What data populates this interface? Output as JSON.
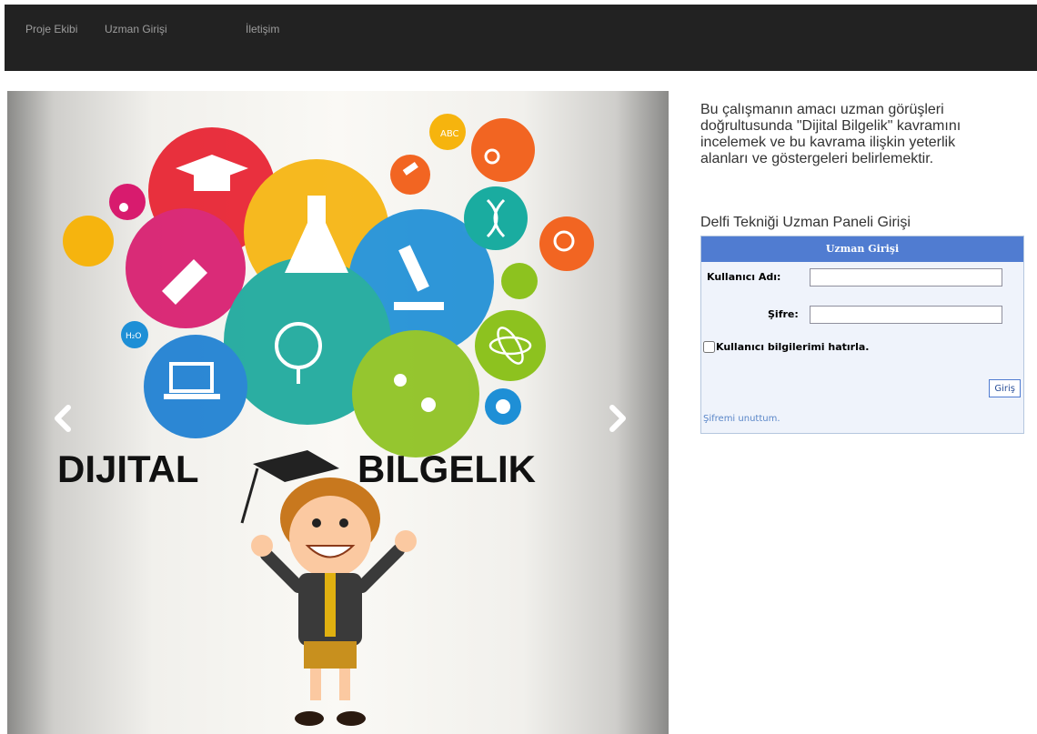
{
  "navbar": {
    "items": [
      {
        "label": "Proje Ekibi"
      },
      {
        "label": "Uzman Girişi"
      },
      {
        "label": "İletişim"
      }
    ],
    "background": "#222222"
  },
  "carousel": {
    "slide_title_left": "DIJITAL",
    "slide_title_right": "BILGELIK",
    "circle_badge_1": "ABC",
    "circle_badge_2": "H₂O",
    "prev_icon": "chevron-left-icon",
    "next_icon": "chevron-right-icon"
  },
  "intro": {
    "text": "Bu çalışmanın amacı uzman görüşleri doğrultusunda \"Dijital Bilgelik\" kavramını incelemek ve bu kavrama ilişkin yeterlik alanları ve göstergeleri belirlemektir."
  },
  "panel_title": "Delfi Tekniği Uzman Paneli Girişi",
  "login": {
    "header": "Uzman Girişi",
    "username_label": "Kullanıcı Adı:",
    "username_value": "",
    "password_label": "Şifre:",
    "password_value": "",
    "remember_label": "Kullanıcı bilgilerimi hatırla.",
    "submit_label": "Giriş",
    "forgot_label": "Şifremi unuttum.",
    "header_color": "#507cd1",
    "box_color": "#eff3fb"
  }
}
